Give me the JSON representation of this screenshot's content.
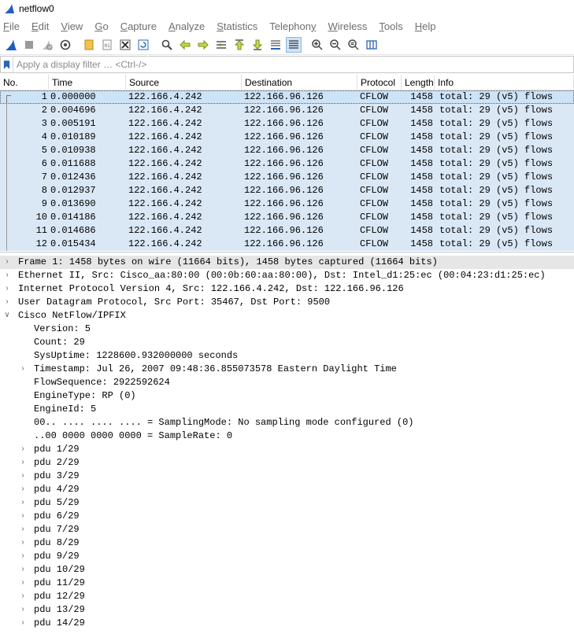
{
  "window": {
    "title": "netflow0"
  },
  "menu": [
    {
      "label": "File",
      "u": "F",
      "rest": "ile"
    },
    {
      "label": "Edit",
      "u": "E",
      "rest": "dit"
    },
    {
      "label": "View",
      "u": "V",
      "rest": "iew"
    },
    {
      "label": "Go",
      "u": "G",
      "rest": "o"
    },
    {
      "label": "Capture",
      "u": "C",
      "rest": "apture"
    },
    {
      "label": "Analyze",
      "u": "A",
      "rest": "nalyze"
    },
    {
      "label": "Statistics",
      "u": "S",
      "rest": "tatistics"
    },
    {
      "label": "Telephony",
      "u": "y",
      "pre": "Telephon",
      "rest": ""
    },
    {
      "label": "Wireless",
      "u": "W",
      "rest": "ireless"
    },
    {
      "label": "Tools",
      "u": "T",
      "rest": "ools"
    },
    {
      "label": "Help",
      "u": "H",
      "rest": "elp"
    }
  ],
  "filter": {
    "placeholder": "Apply a display filter … <Ctrl-/>"
  },
  "columns": [
    "No.",
    "Time",
    "Source",
    "Destination",
    "Protocol",
    "Length",
    "Info"
  ],
  "packets": [
    {
      "no": "1",
      "time": "0.000000",
      "src": "122.166.4.242",
      "dst": "122.166.96.126",
      "proto": "CFLOW",
      "len": "1458",
      "info": "total: 29 (v5) flows"
    },
    {
      "no": "2",
      "time": "0.004696",
      "src": "122.166.4.242",
      "dst": "122.166.96.126",
      "proto": "CFLOW",
      "len": "1458",
      "info": "total: 29 (v5) flows"
    },
    {
      "no": "3",
      "time": "0.005191",
      "src": "122.166.4.242",
      "dst": "122.166.96.126",
      "proto": "CFLOW",
      "len": "1458",
      "info": "total: 29 (v5) flows"
    },
    {
      "no": "4",
      "time": "0.010189",
      "src": "122.166.4.242",
      "dst": "122.166.96.126",
      "proto": "CFLOW",
      "len": "1458",
      "info": "total: 29 (v5) flows"
    },
    {
      "no": "5",
      "time": "0.010938",
      "src": "122.166.4.242",
      "dst": "122.166.96.126",
      "proto": "CFLOW",
      "len": "1458",
      "info": "total: 29 (v5) flows"
    },
    {
      "no": "6",
      "time": "0.011688",
      "src": "122.166.4.242",
      "dst": "122.166.96.126",
      "proto": "CFLOW",
      "len": "1458",
      "info": "total: 29 (v5) flows"
    },
    {
      "no": "7",
      "time": "0.012436",
      "src": "122.166.4.242",
      "dst": "122.166.96.126",
      "proto": "CFLOW",
      "len": "1458",
      "info": "total: 29 (v5) flows"
    },
    {
      "no": "8",
      "time": "0.012937",
      "src": "122.166.4.242",
      "dst": "122.166.96.126",
      "proto": "CFLOW",
      "len": "1458",
      "info": "total: 29 (v5) flows"
    },
    {
      "no": "9",
      "time": "0.013690",
      "src": "122.166.4.242",
      "dst": "122.166.96.126",
      "proto": "CFLOW",
      "len": "1458",
      "info": "total: 29 (v5) flows"
    },
    {
      "no": "10",
      "time": "0.014186",
      "src": "122.166.4.242",
      "dst": "122.166.96.126",
      "proto": "CFLOW",
      "len": "1458",
      "info": "total: 29 (v5) flows"
    },
    {
      "no": "11",
      "time": "0.014686",
      "src": "122.166.4.242",
      "dst": "122.166.96.126",
      "proto": "CFLOW",
      "len": "1458",
      "info": "total: 29 (v5) flows"
    },
    {
      "no": "12",
      "time": "0.015434",
      "src": "122.166.4.242",
      "dst": "122.166.96.126",
      "proto": "CFLOW",
      "len": "1458",
      "info": "total: 29 (v5) flows"
    }
  ],
  "details": {
    "top": [
      {
        "text": "Frame 1: 1458 bytes on wire (11664 bits), 1458 bytes captured (11664 bits)",
        "expanded": false,
        "selected": true
      },
      {
        "text": "Ethernet II, Src: Cisco_aa:80:00 (00:0b:60:aa:80:00), Dst: Intel_d1:25:ec (00:04:23:d1:25:ec)",
        "expanded": false,
        "selected": false
      },
      {
        "text": "Internet Protocol Version 4, Src: 122.166.4.242, Dst: 122.166.96.126",
        "expanded": false,
        "selected": false
      },
      {
        "text": "User Datagram Protocol, Src Port: 35467, Dst Port: 9500",
        "expanded": false,
        "selected": false
      },
      {
        "text": "Cisco NetFlow/IPFIX",
        "expanded": true,
        "selected": false
      }
    ],
    "netflow": [
      {
        "text": "Version: 5",
        "arrow": false
      },
      {
        "text": "Count: 29",
        "arrow": false
      },
      {
        "text": "SysUptime: 1228600.932000000 seconds",
        "arrow": false
      },
      {
        "text": "Timestamp: Jul 26, 2007 09:48:36.855073578 Eastern Daylight Time",
        "arrow": true
      },
      {
        "text": "FlowSequence: 2922592624",
        "arrow": false
      },
      {
        "text": "EngineType: RP (0)",
        "arrow": false
      },
      {
        "text": "EngineId: 5",
        "arrow": false
      },
      {
        "text": "00.. .... .... .... = SamplingMode: No sampling mode configured (0)",
        "arrow": false
      },
      {
        "text": "..00 0000 0000 0000 = SampleRate: 0",
        "arrow": false
      },
      {
        "text": "pdu 1/29",
        "arrow": true
      },
      {
        "text": "pdu 2/29",
        "arrow": true
      },
      {
        "text": "pdu 3/29",
        "arrow": true
      },
      {
        "text": "pdu 4/29",
        "arrow": true
      },
      {
        "text": "pdu 5/29",
        "arrow": true
      },
      {
        "text": "pdu 6/29",
        "arrow": true
      },
      {
        "text": "pdu 7/29",
        "arrow": true
      },
      {
        "text": "pdu 8/29",
        "arrow": true
      },
      {
        "text": "pdu 9/29",
        "arrow": true
      },
      {
        "text": "pdu 10/29",
        "arrow": true
      },
      {
        "text": "pdu 11/29",
        "arrow": true
      },
      {
        "text": "pdu 12/29",
        "arrow": true
      },
      {
        "text": "pdu 13/29",
        "arrow": true
      },
      {
        "text": "pdu 14/29",
        "arrow": true
      }
    ]
  },
  "colors": {
    "row_bg": "#dae8f6",
    "selected_bg": "#cde3f7",
    "tree_selected_bg": "#e6e6e6",
    "menu_text": "#6e6e6e"
  }
}
